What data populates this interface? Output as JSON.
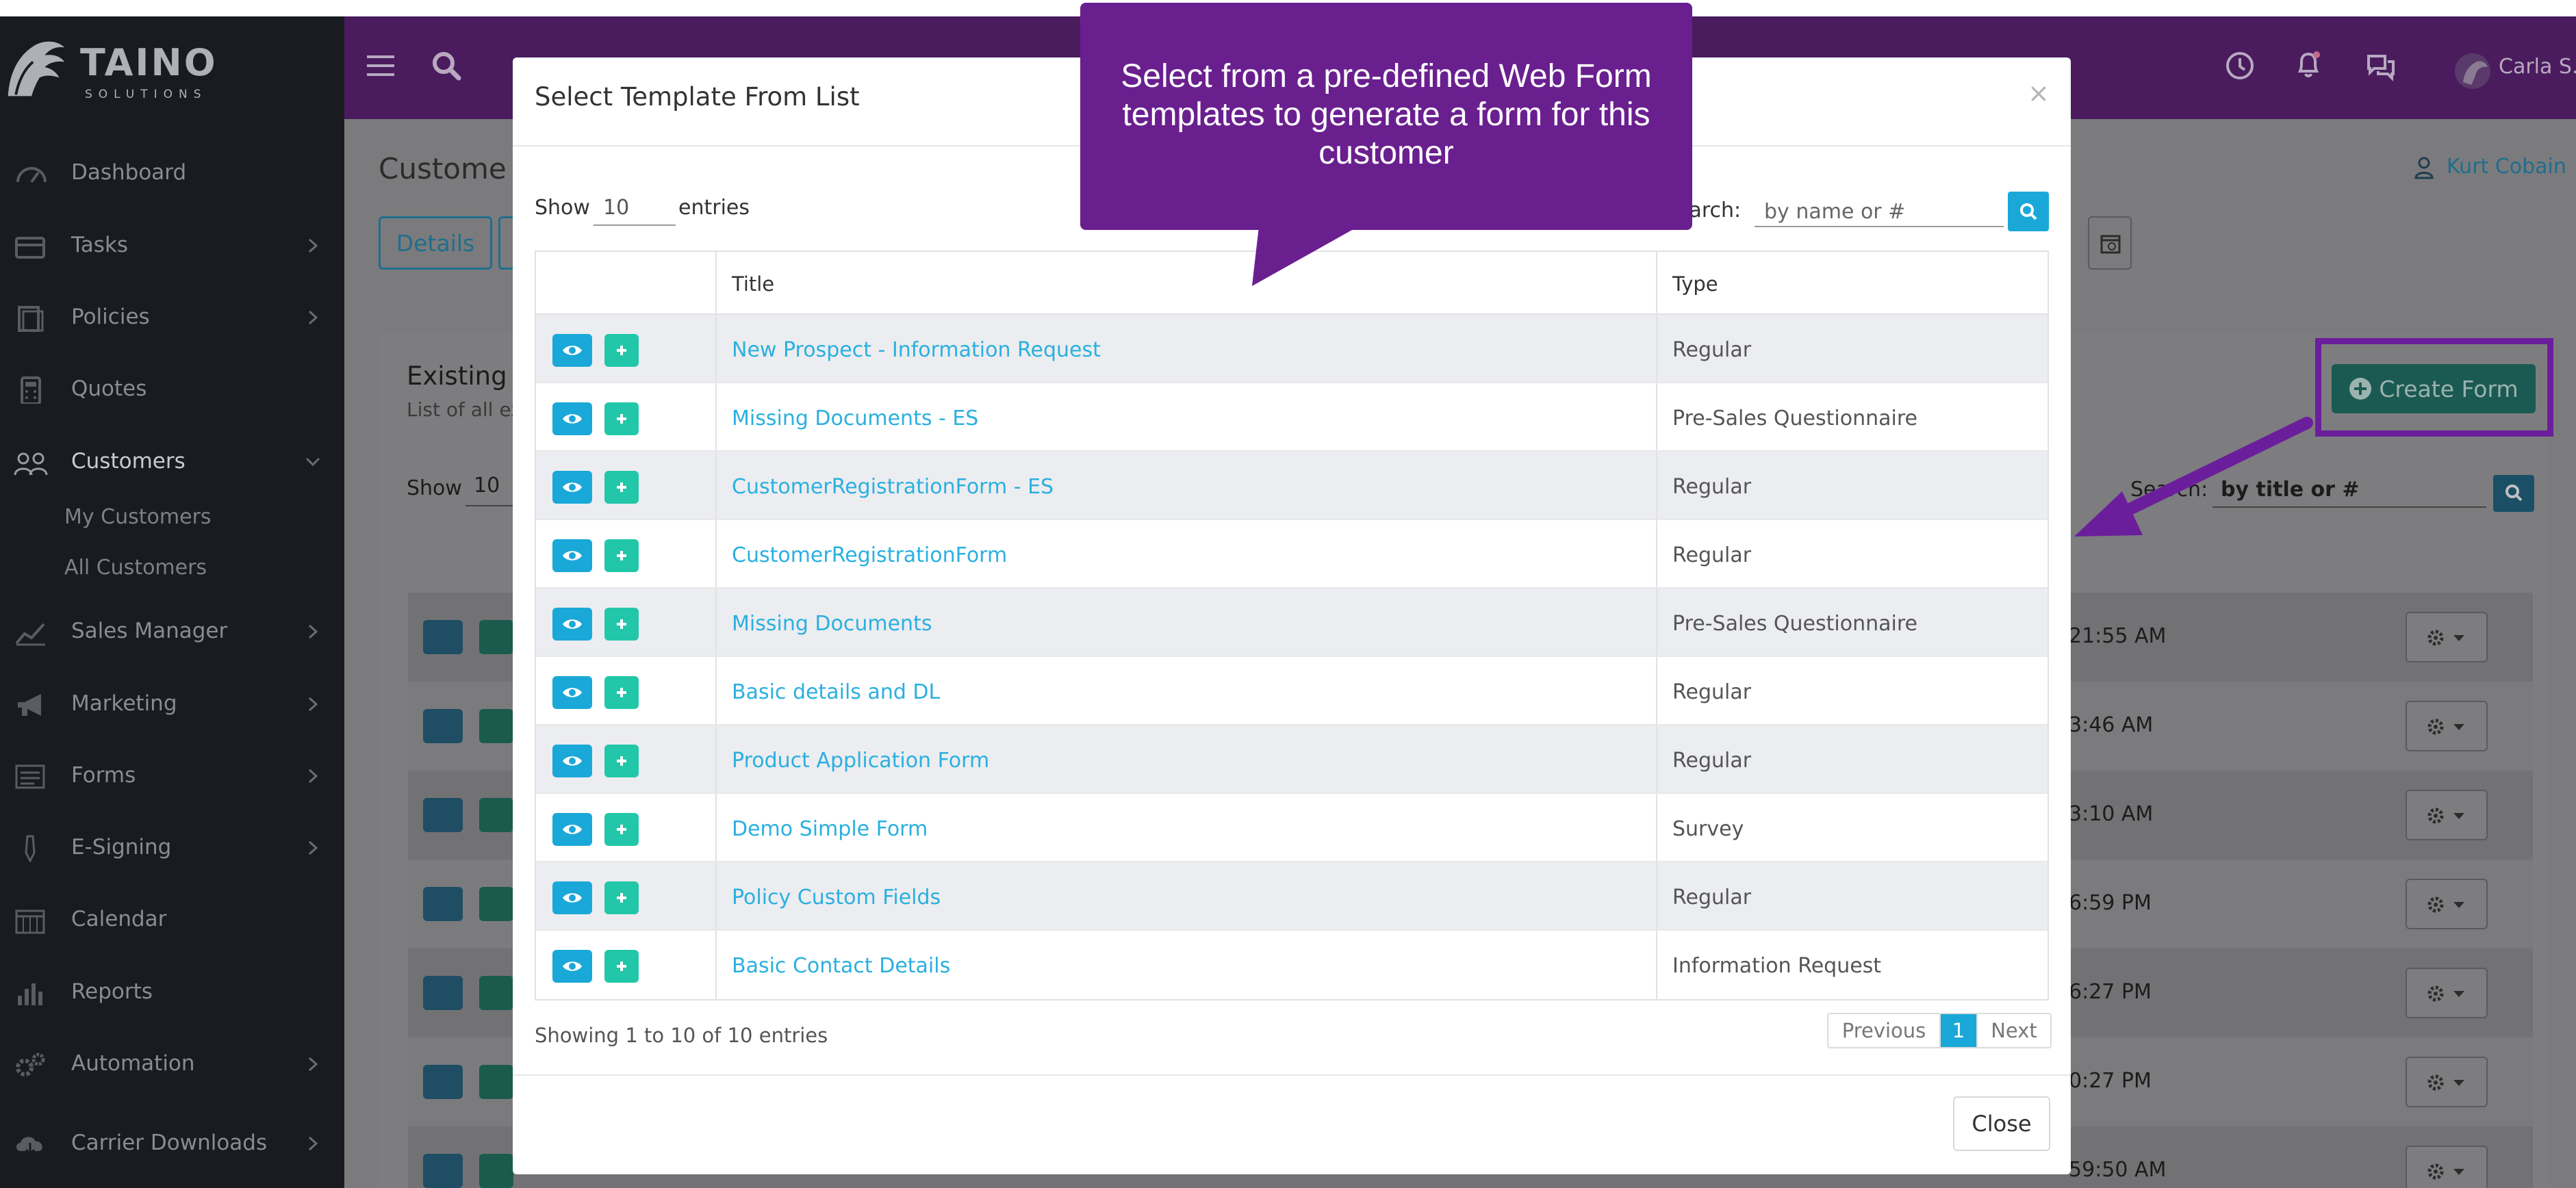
{
  "brand": {
    "name": "TAINO",
    "tagline": "SOLUTIONS"
  },
  "sidebar": {
    "items": [
      {
        "label": "Dashboard",
        "icon": "dashboard-icon",
        "chevron": false
      },
      {
        "label": "Tasks",
        "icon": "tasks-icon",
        "chevron": true
      },
      {
        "label": "Policies",
        "icon": "policies-icon",
        "chevron": true
      },
      {
        "label": "Quotes",
        "icon": "calculator-icon",
        "chevron": false
      },
      {
        "label": "Customers",
        "icon": "customers-icon",
        "chevron": true,
        "active": true
      },
      {
        "label": "Sales Manager",
        "icon": "chart-line-icon",
        "chevron": true
      },
      {
        "label": "Marketing",
        "icon": "megaphone-icon",
        "chevron": true
      },
      {
        "label": "Forms",
        "icon": "forms-icon",
        "chevron": true
      },
      {
        "label": "E-Signing",
        "icon": "pen-icon",
        "chevron": true
      },
      {
        "label": "Calendar",
        "icon": "calendar-icon",
        "chevron": false
      },
      {
        "label": "Reports",
        "icon": "bar-chart-icon",
        "chevron": false
      },
      {
        "label": "Automation",
        "icon": "gears-icon",
        "chevron": true
      },
      {
        "label": "Carrier Downloads",
        "icon": "cloud-download-icon",
        "chevron": true
      }
    ],
    "customer_sub": [
      "My Customers",
      "All Customers"
    ]
  },
  "header": {
    "user_name": "Carla S."
  },
  "background": {
    "page_title": "Custome",
    "details_label": "Details",
    "user_link": "Kurt Cobain",
    "existing_title": "Existing",
    "existing_sub": "List of all ex",
    "show_label": "Show",
    "show_value": "10",
    "search_label": "Search:",
    "search_value": "by title or #",
    "create_form_label": "Create Form",
    "times": [
      "21:55 AM",
      "3:46 AM",
      "3:10 AM",
      "6:59 PM",
      "6:27 PM",
      "0:27 PM",
      "59:50 AM"
    ]
  },
  "modal": {
    "title": "Select Template From List",
    "close_x": "×",
    "show_label": "Show",
    "show_value": "10",
    "entries_label": "entries",
    "search_label": "earch:",
    "search_placeholder": "by name or #",
    "columns": {
      "title": "Title",
      "type": "Type"
    },
    "rows": [
      {
        "title": "New Prospect - Information Request",
        "type": "Regular"
      },
      {
        "title": "Missing Documents - ES",
        "type": "Pre-Sales Questionnaire"
      },
      {
        "title": "CustomerRegistrationForm - ES",
        "type": "Regular"
      },
      {
        "title": "CustomerRegistrationForm",
        "type": "Regular"
      },
      {
        "title": "Missing Documents",
        "type": "Pre-Sales Questionnaire"
      },
      {
        "title": "Basic details and DL",
        "type": "Regular"
      },
      {
        "title": "Product Application Form",
        "type": "Regular"
      },
      {
        "title": "Demo Simple Form",
        "type": "Survey"
      },
      {
        "title": "Policy Custom Fields",
        "type": "Regular"
      },
      {
        "title": "Basic Contact Details",
        "type": "Information Request"
      }
    ],
    "info": "Showing 1 to 10 of 10 entries",
    "pager": {
      "previous": "Previous",
      "page": "1",
      "next": "Next"
    },
    "close_label": "Close"
  },
  "callout": {
    "text": "Select from a pre-defined Web Form templates to generate a form for this customer"
  },
  "colors": {
    "header_purple": "#4a1c5e",
    "callout_purple": "#6a1f8f",
    "link_blue": "#2ab0df",
    "accent_blue": "#1aa8d8",
    "accent_teal": "#22c7a9",
    "highlight_outline": "#6b1e9c"
  }
}
